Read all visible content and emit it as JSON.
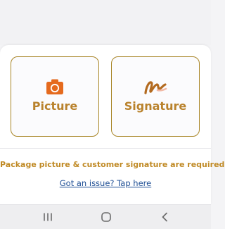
{
  "actions": {
    "picture": {
      "label": "Picture",
      "icon": "camera-icon"
    },
    "signature": {
      "label": "Signature",
      "icon": "signature-icon"
    }
  },
  "notice": "Package picture & customer signature are required",
  "issue_link": "Got an issue? Tap here",
  "nav": {
    "recents_icon": "recents-icon",
    "home_icon": "home-icon",
    "back_icon": "back-icon"
  },
  "colors": {
    "accent": "#b9822c",
    "camera": "#e56a1e",
    "link": "#1f4f95",
    "card_border": "#a88526"
  }
}
